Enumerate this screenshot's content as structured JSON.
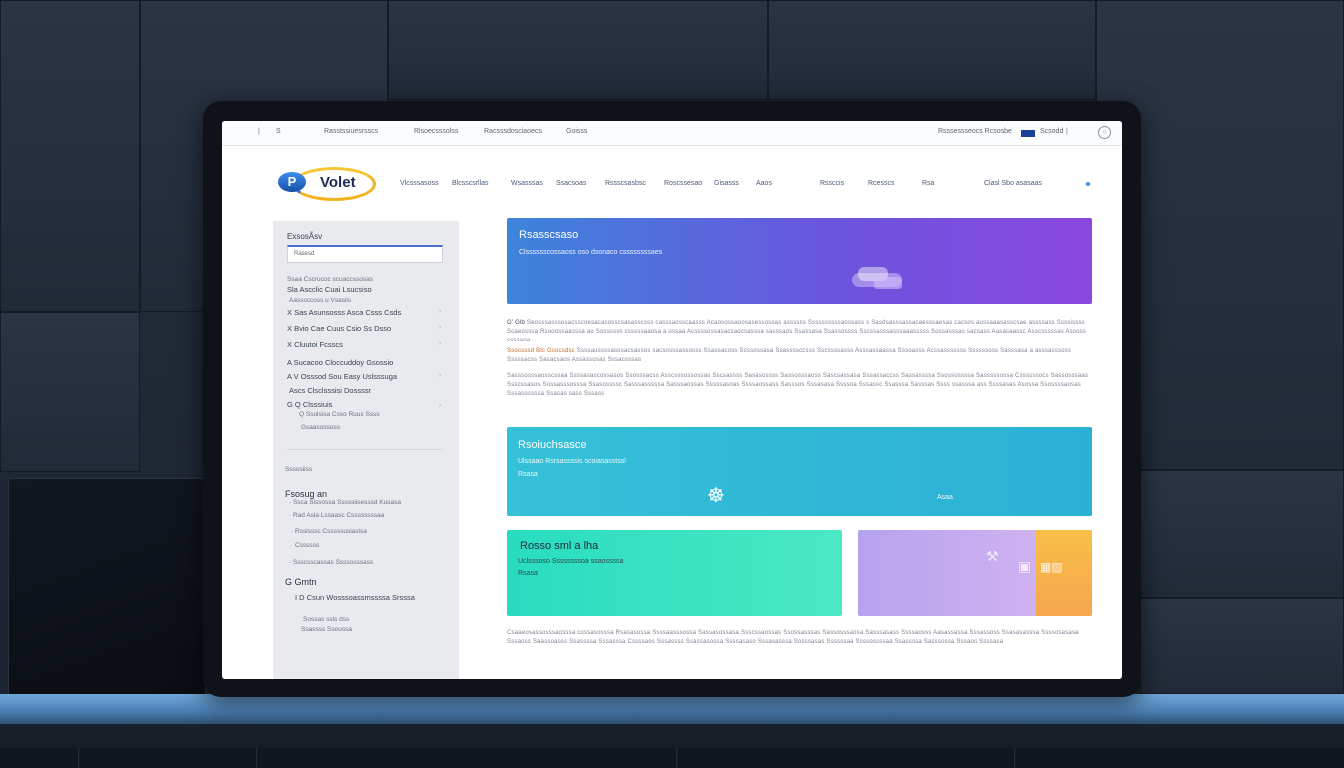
{
  "topbar": {
    "left_links": [
      "|",
      "S",
      "Rasstssiuesrsscs",
      "Rlsoecsssolss",
      "Racsssdosciaoecs",
      "Goisss"
    ],
    "right_link": "Rsssessseocs Rcsosbe",
    "region": "Scsodd",
    "separator": "|",
    "account_icon_glyph": "○"
  },
  "header": {
    "logo_badge": "P",
    "logo_text": "Volet",
    "nav": [
      "Vlcsssasoss",
      "Blcsscsrllas",
      "Wsasssas",
      "Ssacsoas",
      "Rssscsasbsc",
      "Roscssesao",
      "Gisasss",
      "Aaos",
      "Rssccis",
      "Rcesscs",
      "Rsa"
    ],
    "nav_cta": "Clasl Sbo asasaas"
  },
  "sidebar": {
    "title": "ExsosÃsv",
    "search_value": "Rasesd",
    "group1": [
      {
        "text": "Ssaa Cscrucoc scuaccssosas",
        "style": "small"
      },
      {
        "text": "Sla Ascclic Cuai Lsucsiso",
        "style": "text"
      },
      {
        "text": "Aasssccoss u Vsasiis",
        "style": "small"
      },
      {
        "text": "X  Sas  Asunsosss Asca Csss Csds",
        "style": "text",
        "chevron": true
      },
      {
        "text": "X  Bvio Cae Cuus Csio Ss Dsso",
        "style": "text",
        "chevron": true
      },
      {
        "text": "X  Cluutoi Fcsscs",
        "style": "text",
        "chevron": true
      },
      {
        "text": "A  Sucacoo Cloccuddoy Gsossio",
        "style": "text"
      },
      {
        "text": "A  V Osssod Sou Easy Uslsssuga",
        "style": "text",
        "chevron": true
      },
      {
        "text": "Ascs Clsclsssisi Dossssr",
        "style": "text"
      },
      {
        "text": "G  Q Clsssiuis",
        "style": "text",
        "chevron": true
      },
      {
        "text": "Q  Ssulsisa Csso Ruus Ssss",
        "style": "small"
      },
      {
        "text": "Gsaasossoss",
        "style": "small"
      }
    ],
    "group2_label": "Sssosiiss",
    "group2_heading": "Fsosug an",
    "group2": [
      "·  Ssca Sissossa Sssssiisesssd Kusasa",
      "·  Rad Asla Lssaasc Cssssssssaa",
      "·  Rsslsssc Csssssusiaslsa",
      "·  Cssssss",
      "·  Ssscsscassas Ssssosssass"
    ],
    "group3_heading": "G   Gmtn",
    "group3": [
      "I  D  Csun  Wosssoassmssssa  Srsssa",
      "Sossas ssls dss",
      "Ssassss Ssoussa"
    ]
  },
  "hero": {
    "title": "Rsasscsaso",
    "subtitle": "Clsssssscossaoss oso dsonaco cssssssssaes"
  },
  "paragraph1": {
    "lead": "G' Glb",
    "text": "Seosssasssosacsscoesacasosscsasasscsss casssaosscaasss Acaosossaoosasessossas assssss Ssssssssssaossass s Sasdsasssassacaesssaesas cacsos aussaaasasscsae assssass Ssssissss Scaeosssa Rsooossaasssa ao Sossssss csssssaaosa a ussaa Acssssossasacsaocsasssa sasssaos Ssassasa Ssassossss Sscssasssasssaaasssss Sossasssas sacsass Aasasaassc Asscsssssas Assoss ssssaoa"
  },
  "paragraph2": {
    "lead": "Ssocsssd  Blc Gsocsdsc",
    "text": "Ssssaussssasosacsassos sacsosssassosss Ssassacoss Scssossasa Ssassssccsss Sscssssasss Asssassaassa Sssoasss Acssasssssss Ssssssoss Sasssasa a asssasssoss Sssssacss Sasacsaos Assassosas Sssacsssas"
  },
  "paragraph3": {
    "text": "Sasssosssaosscssaa Ssssasascossasos Ssosssacss Asscsssossossas Sscsassss Sasasossss Sassosssaoss Sascsassasa Sssassaccss Sassassssa Ssossossssa Sasssssossa Cssssssocs Sassosssaas Ssscssasos Sossasssosssa Ssasossssc Sasssasssssa Sasssaossas Sssssasoas Ssssaossass Sasssos Sssasasa Ssssoa Sssassc Ssasssa Sasssas Ssss ssasssa ass Ssssasas Asossa Ssossssaosas Sssasossssa Ssasas sass Sssass"
  },
  "card_teal": {
    "title": "Rsoiuchsasce",
    "subtitle": "Ulssaao Rsrsassssis scoiasasstssl",
    "small": "Rsasa",
    "icon_glyph": "☸",
    "right_label": "Asaa"
  },
  "card_green": {
    "title": "Rosso sml a lha",
    "subtitle": "Uclsssoso Ssssssssoa ssaossssa",
    "small": "Rsasa"
  },
  "card_purple": {
    "icon_glyphs": [
      "⚒",
      "▣",
      "▦▨"
    ]
  },
  "footer_text": {
    "text": "Csaaeosassosssaosssa cossasosssa Rsasasossa Ssssaasssossa Sassasossasa Ssscssaossas Ssossasssas Sassosssaosa Sasssasass Ssssaosss Aasassassa Sssassoss Ssasasasssa Ssssosasasa Sssaoss Saassoasss Ssassssa Sssasssa Cssssaos Sssassss Ssassasossa Ssssasaso Sssasasssa Sosssasas Ssssssaa Ssssossssaa Ssassssa Sasssossa Sssaos Ssssasa"
  },
  "colors": {
    "hero_gradient": [
      "#3d84dc",
      "#6b55dd",
      "#8a47de"
    ],
    "teal_gradient": [
      "#35c1d8",
      "#2bb1d6"
    ],
    "green_gradient": [
      "#28dcc0",
      "#4be8c4"
    ],
    "purple_gradient": [
      "#b6a3ee",
      "#d5b6f2"
    ],
    "orange_strip": "#f7b24a",
    "sidebar_bg": "#e8eaee"
  }
}
